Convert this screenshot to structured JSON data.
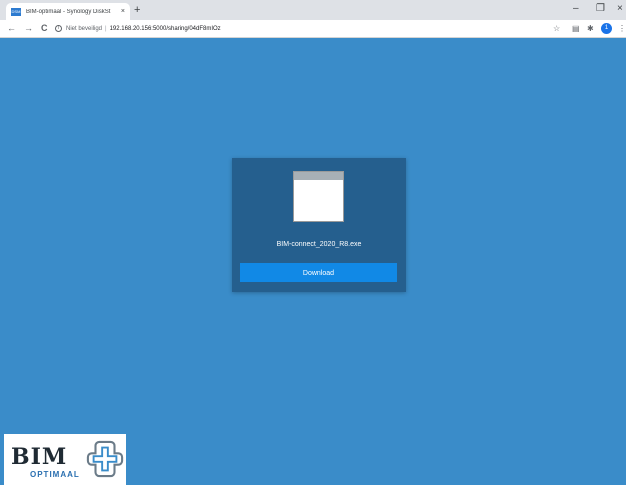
{
  "browser": {
    "tab": {
      "favicon_text": "DSM",
      "title": "BIM-optimaal - Synology DiskSt",
      "close_glyph": "×"
    },
    "new_tab_glyph": "+",
    "window_controls": {
      "minimize": "–",
      "maximize": "❐",
      "close": "×"
    },
    "nav": {
      "back": "←",
      "forward": "→",
      "reload": "C"
    },
    "address": {
      "info_glyph": "i",
      "security_label": "Niet beveiligd",
      "separator": "|",
      "url": "192.168.20.156:5000/sharing/04dF8mIOz"
    },
    "toolbar_icons": {
      "star": "☆",
      "extension": "▤",
      "puzzle": "✱",
      "profile": "1",
      "menu": "⋮"
    }
  },
  "share": {
    "file_name": "BIM-connect_2020_R8.exe",
    "download_label": "Download",
    "button_color": "#1189e6",
    "card_color": "#255f8e",
    "page_color": "#3a8cc9"
  },
  "logo": {
    "main_text": "BIM",
    "sub_text": "OPTIMAAL"
  }
}
